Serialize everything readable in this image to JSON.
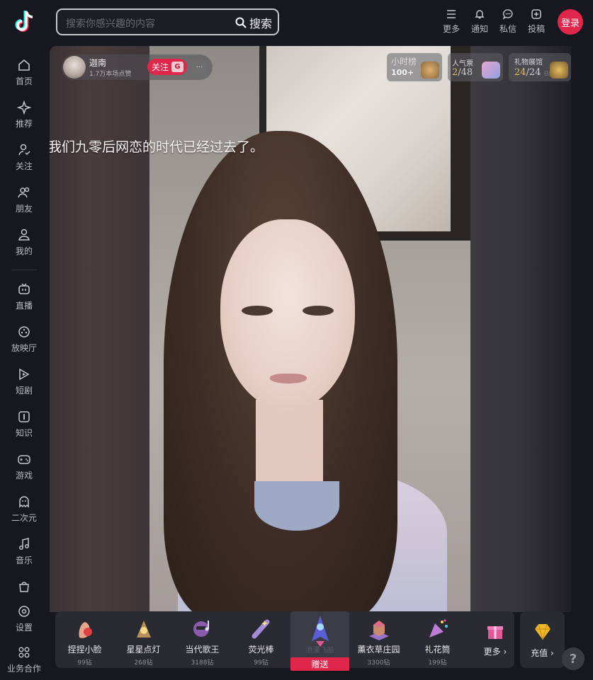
{
  "header": {
    "search_placeholder": "搜索你感兴趣的内容",
    "search_button": "搜索",
    "actions": [
      {
        "label": "更多",
        "icon": "menu-icon"
      },
      {
        "label": "通知",
        "icon": "bell-icon"
      },
      {
        "label": "私信",
        "icon": "message-icon"
      },
      {
        "label": "投稿",
        "icon": "upload-icon"
      }
    ],
    "login": "登录"
  },
  "sidebar": {
    "items": [
      {
        "label": "首页",
        "icon": "home-icon"
      },
      {
        "label": "推荐",
        "icon": "sparkle-icon"
      },
      {
        "label": "关注",
        "icon": "follow-icon"
      },
      {
        "label": "朋友",
        "icon": "friends-icon"
      },
      {
        "label": "我的",
        "icon": "user-icon"
      },
      {
        "label": "直播",
        "icon": "tv-icon"
      },
      {
        "label": "放映厅",
        "icon": "film-icon"
      },
      {
        "label": "短剧",
        "icon": "short-drama-icon"
      },
      {
        "label": "知识",
        "icon": "knowledge-icon"
      },
      {
        "label": "游戏",
        "icon": "gamepad-icon"
      },
      {
        "label": "二次元",
        "icon": "ghost-icon"
      },
      {
        "label": "音乐",
        "icon": "music-icon"
      }
    ],
    "bottom": [
      {
        "label": "设置",
        "icon": "settings-icon"
      },
      {
        "label": "业务合作",
        "icon": "grid-icon"
      }
    ]
  },
  "stream": {
    "streamer_name": "迦南",
    "likes": "1.7万本场点赞",
    "follow": "关注",
    "follow_badge": "G",
    "more": "···",
    "hour_rank_title": "小时榜",
    "hour_rank_value": "100+",
    "popularity_title": "人气票",
    "popularity_current": "2",
    "popularity_total": "/48",
    "gallery_title": "礼物展馆",
    "gallery_current": "24",
    "gallery_total": "/24",
    "gallery_tag": "已集齐",
    "danmaku": "我们九零后网恋的时代已经过去了。"
  },
  "gifts": [
    {
      "name": "捏捏小脸",
      "price": "99钻",
      "color": "#e5a58a"
    },
    {
      "name": "星星点灯",
      "price": "268钻",
      "color": "#b8905a"
    },
    {
      "name": "当代歌王",
      "price": "3188钻",
      "color": "#8a5bb0"
    },
    {
      "name": "荧光棒",
      "price": "99钻",
      "color": "#a48cd8"
    },
    {
      "name": "浪漫飞船",
      "price": "",
      "color": "#5a5fd8",
      "send": "赠送"
    },
    {
      "name": "薰衣草庄园",
      "price": "3300钻",
      "color": "#9a72c8"
    },
    {
      "name": "礼花筒",
      "price": "199钻",
      "color": "#c07ad8"
    }
  ],
  "gift_more": "更多",
  "recharge": "充值",
  "help": "?",
  "colors": {
    "accent": "#e0264a",
    "background": "#17181f",
    "panel": "#2a2b32"
  }
}
